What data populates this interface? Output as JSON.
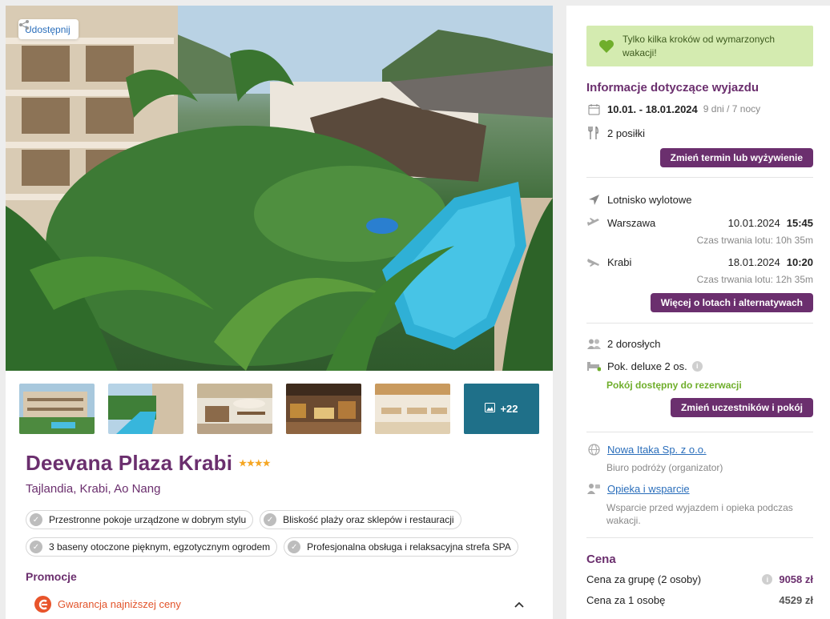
{
  "share": {
    "label": "Udostępnij"
  },
  "thumbnails": {
    "more_label": "+22"
  },
  "hotel": {
    "name": "Deevana Plaza Krabi",
    "stars": 4,
    "stars_text": "★★★★",
    "location": "Tajlandia, Krabi, Ao Nang"
  },
  "features": [
    "Przestronne pokoje urządzone w dobrym stylu",
    "Bliskość plaży oraz sklepów i restauracji",
    "3 baseny otoczone pięknym, egzotycznym ogrodem",
    "Profesjonalna obsługa i relaksacyjna strefa SPA"
  ],
  "promotions": {
    "title": "Promocje",
    "item": "Gwarancja najniższej ceny"
  },
  "banner": {
    "text": "Tylko kilka kroków od wymarzonych wakacji!"
  },
  "trip": {
    "title": "Informacje dotyczące wyjazdu",
    "dates": "10.01. - 18.01.2024",
    "duration": "9 dni / 7 nocy",
    "meals": "2 posiłki",
    "change_button": "Zmień termin lub wyżywienie"
  },
  "flights": {
    "title": "Lotnisko wylotowe",
    "outbound": {
      "city": "Warszawa",
      "date": "10.01.2024",
      "time": "15:45",
      "duration": "Czas trwania lotu: 10h 35m"
    },
    "inbound": {
      "city": "Krabi",
      "date": "18.01.2024",
      "time": "10:20",
      "duration": "Czas trwania lotu: 12h 35m"
    },
    "more_button": "Więcej o lotach i alternatywach"
  },
  "participants": {
    "adults": "2 dorosłych",
    "room": "Pok. deluxe 2 os.",
    "availability": "Pokój dostępny do rezerwacji",
    "change_button": "Zmień uczestników i pokój"
  },
  "organizer": {
    "name": "Nowa Itaka Sp. z o.o.",
    "role": "Biuro podróży (organizator)",
    "support_link": "Opieka i wsparcie",
    "support_text": "Wsparcie przed wyjazdem i opieka podczas wakacji."
  },
  "price": {
    "title": "Cena",
    "group_label": "Cena za grupę (2 osoby)",
    "group_value": "9058 zł",
    "person_label": "Cena za 1 osobę",
    "person_value": "4529 zł"
  },
  "colors": {
    "brand": "#6b2f6e",
    "link": "#2a6ebb",
    "success": "#6fae2b",
    "banner_bg": "#d4ebb0",
    "promo": "#e2542b",
    "star": "#f5a623"
  }
}
